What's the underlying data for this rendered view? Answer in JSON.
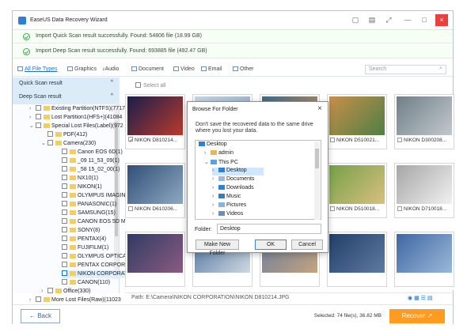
{
  "window": {
    "title": "EaseUS Data Recovery Wizard",
    "accent": "#2f7fd6"
  },
  "notices": [
    {
      "text": "Import Quick Scan result successfully.  Found: 54806 file (18.99 GB)"
    },
    {
      "text": "Import Deep Scan result successfully.  Found: 693885 file (492.47 GB)"
    }
  ],
  "filters": {
    "tabs": [
      "All File Types",
      "Graphics",
      "Audio",
      "Document",
      "Video",
      "Email",
      "Other"
    ],
    "search_placeholder": "Search"
  },
  "sidebar": {
    "quick": "Quick Scan result",
    "deep": "Deep Scan result",
    "tree": [
      "Existing Partition(NTFS)(7717",
      "Lost Partition1(HFS+)(41084",
      "Special Lost Files(Label)(972",
      "PDF(412)",
      "Camera(230)",
      "Canon EOS 6D(1)",
      "_09 11_53_09(1)",
      "_58 15_02_00(1)",
      "NX10(1)",
      "NIKON(1)",
      "OLYMPUS IMAGIN",
      "PANASONIC(1)",
      "SAMSUNG(15)",
      "CANON EOS 5D M",
      "SONY(8)",
      "PENTAX(4)",
      "FUJIFILM(1)",
      "OLYMPUS OPTICA",
      "PENTAX CORPORA",
      "NIKON CORPORAT",
      "CANON(110)",
      "Office(330)",
      "More Lost Files(Raw)(11023"
    ]
  },
  "gallery": {
    "select_all": "Select all",
    "tiles": [
      {
        "label": "NIKON D810214...",
        "checked": true,
        "colors": [
          "#1a1d4b",
          "#b83b2d"
        ]
      },
      {
        "label": "",
        "checked": false,
        "colors": [
          "#c7d7e8",
          "#8aa6c5"
        ]
      },
      {
        "label": "",
        "checked": false,
        "colors": [
          "#3d6a8a",
          "#d79352"
        ]
      },
      {
        "label": "NIKON D510021...",
        "checked": false,
        "colors": [
          "#c78f49",
          "#4f7f46"
        ]
      },
      {
        "label": "NIKON D300208...",
        "checked": false,
        "colors": [
          "#6f7f88",
          "#c2c8cd"
        ]
      },
      {
        "label": "NIKON D610206...",
        "checked": false,
        "colors": [
          "#314f76",
          "#8ea8c2"
        ]
      },
      {
        "label": "",
        "checked": false,
        "colors": [
          "#6f9a53",
          "#b7d27f"
        ]
      },
      {
        "label": "",
        "checked": false,
        "colors": [
          "#2f3f64",
          "#6c8db4"
        ]
      },
      {
        "label": "NIKON D510018...",
        "checked": false,
        "colors": [
          "#76a148",
          "#d8bf80"
        ]
      },
      {
        "label": "NIKON D710018...",
        "checked": false,
        "colors": [
          "#a6a6a6",
          "#f0f0f0"
        ]
      },
      {
        "label": "",
        "checked": false,
        "colors": [
          "#313b63",
          "#8a5b82"
        ]
      },
      {
        "label": "",
        "checked": false,
        "colors": [
          "#4f73a0",
          "#cfd9e0"
        ]
      },
      {
        "label": "",
        "checked": false,
        "colors": [
          "#6c7c9d",
          "#c3a37f"
        ]
      },
      {
        "label": "",
        "checked": false,
        "colors": [
          "#233f69",
          "#5d7aa0"
        ]
      },
      {
        "label": "",
        "checked": false,
        "colors": [
          "#3e67a4",
          "#9bb8d7"
        ]
      }
    ]
  },
  "path": "Path:   E:\\Camera\\NIKON CORPORATION\\NIKON D810214.JPG",
  "footer": {
    "back": "← Back",
    "selected": "Selected: 74 file(s), 36.82 MB",
    "recover": "Recover ↗"
  },
  "dialog": {
    "title": "Browse For Folder",
    "message": "Don't save the recovered data to the same drive where you lost your data.",
    "tree": [
      "Desktop",
      "admin",
      "This PC",
      "Desktop",
      "Documents",
      "Downloads",
      "Music",
      "Pictures",
      "Videos"
    ],
    "folder_label": "Folder:",
    "folder_value": "Desktop",
    "buttons": [
      "Make New Folder",
      "OK",
      "Cancel"
    ]
  }
}
